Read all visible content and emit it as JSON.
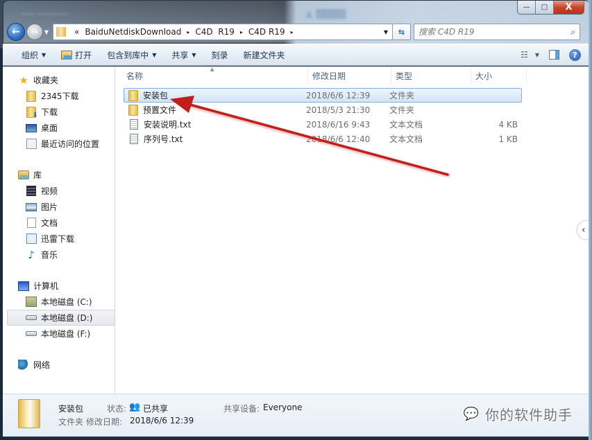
{
  "window": {
    "controls": {
      "minimize": "—",
      "maximize": "□",
      "close": "X"
    }
  },
  "navbar": {
    "back_icon": "back-arrow-icon",
    "forward_icon": "forward-arrow-icon",
    "breadcrumb_overflow": "«",
    "breadcrumbs": [
      "BaiduNetdiskDownload",
      "C4D  R19",
      "C4D R19"
    ],
    "separator": "▸",
    "refresh_glyph": "⇆",
    "search_placeholder": "搜索 C4D R19"
  },
  "commandbar": {
    "items": [
      {
        "label": "组织",
        "has_caret": true
      },
      {
        "label": "打开",
        "has_icon": true
      },
      {
        "label": "包含到库中",
        "has_caret": true
      },
      {
        "label": "共享",
        "has_caret": true
      },
      {
        "label": "刻录"
      },
      {
        "label": "新建文件夹"
      }
    ],
    "views_glyph": "☷",
    "help_glyph": "?"
  },
  "navpane": {
    "favorites": {
      "label": "收藏夹",
      "items": [
        "2345下载",
        "下载",
        "桌面",
        "最近访问的位置"
      ]
    },
    "libraries": {
      "label": "库",
      "items": [
        "视频",
        "图片",
        "文档",
        "迅雷下载",
        "音乐"
      ]
    },
    "computer": {
      "label": "计算机",
      "items": [
        "本地磁盘 (C:)",
        "本地磁盘 (D:)",
        "本地磁盘 (F:)"
      ],
      "selected": "本地磁盘 (D:)"
    },
    "network": {
      "label": "网络"
    }
  },
  "filelist": {
    "columns": {
      "name": "名称",
      "date": "修改日期",
      "type": "类型",
      "size": "大小"
    },
    "sort_indicator": "▲",
    "rows": [
      {
        "name": "安装包",
        "date": "2018/6/6 12:39",
        "type": "文件夹",
        "size": "",
        "kind": "folder",
        "selected": true
      },
      {
        "name": "预置文件",
        "date": "2018/5/3 21:30",
        "type": "文件夹",
        "size": "",
        "kind": "folder",
        "selected": false
      },
      {
        "name": "安装说明.txt",
        "date": "2018/6/16 9:43",
        "type": "文本文档",
        "size": "4 KB",
        "kind": "txt",
        "selected": false
      },
      {
        "name": "序列号.txt",
        "date": "2018/6/6 12:40",
        "type": "文本文档",
        "size": "1 KB",
        "kind": "txt",
        "selected": false
      }
    ],
    "collapse_glyph": "‹"
  },
  "annotation": {
    "arrow_color": "#c0201c",
    "points_to": "安装包"
  },
  "details": {
    "name": "安装包",
    "type": "文件夹",
    "status_label": "状态:",
    "status_value": "已共享",
    "modified_label": "修改日期:",
    "modified_value": "2018/6/6 12:39",
    "shared_with_label": "共享设备:",
    "shared_with_value": "Everyone"
  },
  "watermark": {
    "icon": "wechat-icon",
    "text": "你的软件助手"
  }
}
